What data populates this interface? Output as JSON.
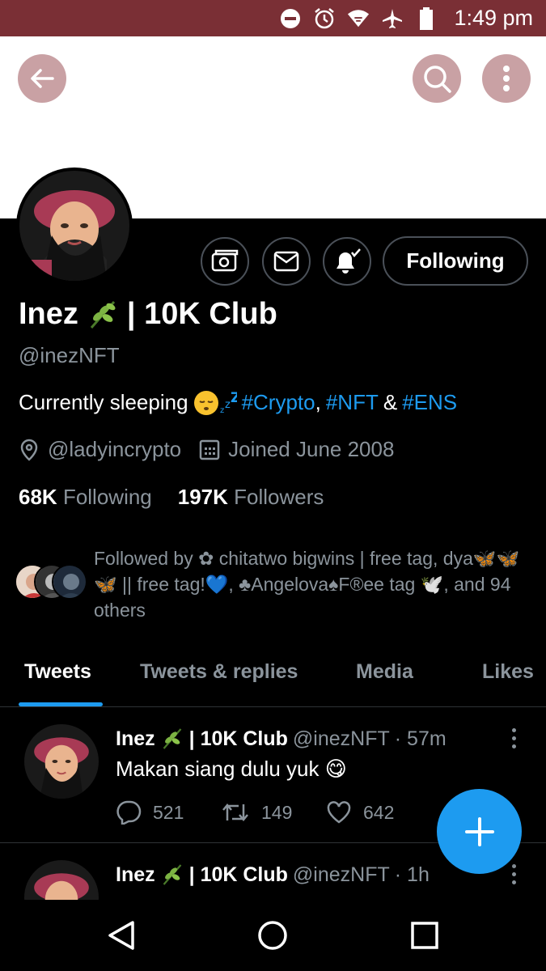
{
  "status_bar": {
    "time": "1:49 pm",
    "icons": [
      "do-not-disturb-icon",
      "alarm-icon",
      "wifi-icon",
      "airplane-icon",
      "battery-icon"
    ],
    "color": "#7a2f35"
  },
  "header": {
    "back_icon": "arrow-left-icon",
    "search_icon": "search-icon",
    "more_icon": "more-vertical-icon",
    "button_color": "#c9a1a4"
  },
  "profile": {
    "name": "Inez",
    "name_suffix": "| 10K Club",
    "handle": "@inezNFT",
    "bio_prefix": "Currently sleeping",
    "bio_tags": [
      "#Crypto",
      ",",
      "#NFT",
      "&",
      "#ENS"
    ],
    "location": "@ladyincrypto",
    "joined": "Joined June 2008",
    "following_count": "68K",
    "following_label": "Following",
    "followers_count": "197K",
    "followers_label": "Followers",
    "following_button": "Following",
    "followed_by": "Followed by ✿ chitatwo bigwins | free tag, dya🦋🦋🦋 || free tag!💙, ♣Angelova♠F®ee tag 🕊️, and 94 others"
  },
  "tabs": [
    {
      "label": "Tweets",
      "active": true
    },
    {
      "label": "Tweets & replies",
      "active": false
    },
    {
      "label": "Media",
      "active": false
    },
    {
      "label": "Likes",
      "active": false
    }
  ],
  "tweets": [
    {
      "name": "Inez",
      "name_suffix": "| 10K Club",
      "handle": "@inezNFT",
      "time": "· 57m",
      "text": "Makan siang dulu yuk 😋",
      "replies": "521",
      "retweets": "149",
      "likes": "642"
    },
    {
      "name": "Inez",
      "name_suffix": "| 10K Club",
      "handle": "@inezNFT",
      "time": "· 1h"
    }
  ],
  "accent_color": "#1d9bf0"
}
